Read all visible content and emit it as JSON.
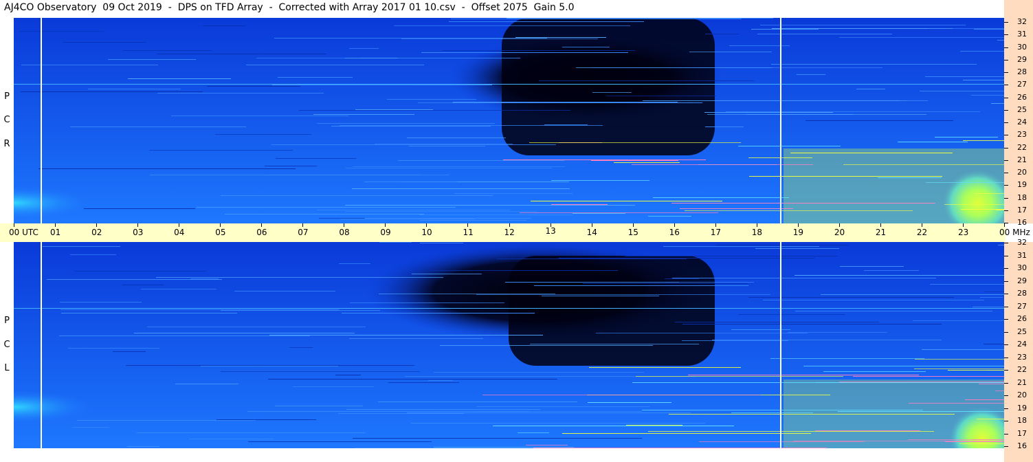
{
  "title": "AJ4CO Observatory  09 Oct 2019  -  DPS on TFD Array  -  Corrected with Array 2017 01 10.csv  -  Offset 2075  Gain 5.0",
  "panels": {
    "top": {
      "polarization": [
        "R",
        "C",
        "P"
      ]
    },
    "bottom": {
      "polarization": [
        "L",
        "C",
        "P"
      ]
    }
  },
  "time_axis": {
    "labels": [
      "00 UTC",
      "01",
      "02",
      "03",
      "04",
      "05",
      "06",
      "07",
      "08",
      "09",
      "10",
      "11",
      "12",
      "13",
      "14",
      "15",
      "16",
      "17",
      "18",
      "19",
      "20",
      "21",
      "22",
      "23",
      "00 MHz"
    ]
  },
  "frequency_axis": {
    "labels": [
      "32",
      "31",
      "30",
      "29",
      "28",
      "27",
      "26",
      "25",
      "24",
      "23",
      "22",
      "21",
      "20",
      "19",
      "18",
      "17",
      "16"
    ]
  },
  "colors": {
    "background_blue": "#1a5cff",
    "dark": "#000010",
    "cyan": "#20d0ff",
    "yellow": "#e8ff40",
    "timebar": "#ffffc8",
    "axis": "#ffdcc0"
  }
}
